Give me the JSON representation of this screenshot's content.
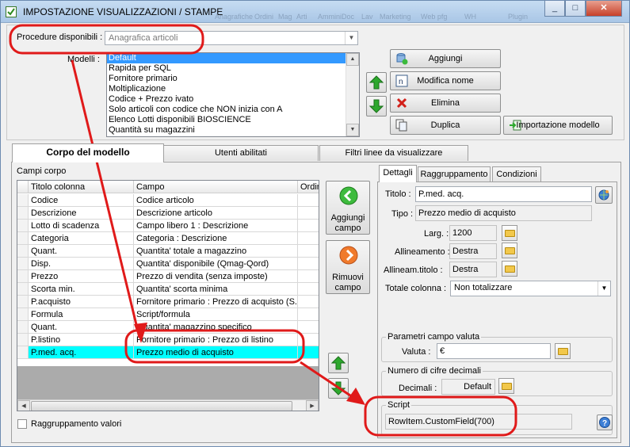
{
  "window": {
    "title": "IMPOSTAZIONE VISUALIZZAZIONI / STAMPE",
    "background_menu": [
      "Anagrafiche",
      "Ordini",
      "Mag",
      "Arti",
      "Ammini",
      "Doc",
      "Lav",
      "Marketing",
      "Web pfg",
      "WH",
      "Plugin"
    ]
  },
  "procedure": {
    "label": "Procedure disponibili :",
    "value": "Anagrafica articoli"
  },
  "modelli": {
    "label": "Modelli :",
    "items": [
      "Default",
      "Rapida per SQL",
      "Fornitore primario",
      "Moltiplicazione",
      "Codice + Prezzo ivato",
      "Solo articoli con codice che NON inizia con A",
      "Elenco Lotti disponibili BIOSCIENCE",
      "Quantità su magazzini"
    ],
    "selected_index": 0
  },
  "buttons": {
    "aggiungi": "Aggiungi",
    "modifica_nome": "Modifica nome",
    "elimina": "Elimina",
    "duplica": "Duplica",
    "importazione_modello": "Importazione modello",
    "aggiungi_campo_1": "Aggiungi",
    "aggiungi_campo_2": "campo",
    "rimuovi_campo_1": "Rimuovi",
    "rimuovi_campo_2": "campo"
  },
  "tabs": [
    "Corpo del modello",
    "Utenti abilitati",
    "Filtri linee da visualizzare"
  ],
  "campi_corpo": {
    "label": "Campi corpo",
    "columns": [
      "Titolo colonna",
      "Campo",
      "Ordin"
    ],
    "rows": [
      {
        "titolo": "Codice",
        "campo": "Codice articolo"
      },
      {
        "titolo": "Descrizione",
        "campo": "Descrizione articolo"
      },
      {
        "titolo": "Lotto di scadenza",
        "campo": "Campo libero 1 : Descrizione"
      },
      {
        "titolo": "Categoria",
        "campo": "Categoria : Descrizione"
      },
      {
        "titolo": "Quant.",
        "campo": "Quantita' totale a magazzino"
      },
      {
        "titolo": "Disp.",
        "campo": "Quantita' disponibile (Qmag-Qord)"
      },
      {
        "titolo": "Prezzo",
        "campo": "Prezzo di vendita (senza imposte)"
      },
      {
        "titolo": "Scorta min.",
        "campo": "Quantita' scorta minima"
      },
      {
        "titolo": "P.acquisto",
        "campo": "Fornitore primario : Prezzo di acquisto (S..."
      },
      {
        "titolo": "Formula",
        "campo": "Script/formula"
      },
      {
        "titolo": "Quant.",
        "campo": "Quantita' magazzino specifico"
      },
      {
        "titolo": "P.listino",
        "campo": "Fornitore primario : Prezzo di listino"
      },
      {
        "titolo": "P.med. acq.",
        "campo": "Prezzo medio di acquisto"
      }
    ],
    "selected_index": 12
  },
  "raggruppamento_valori": {
    "label": "Raggruppamento valori",
    "checked": false
  },
  "detail_tabs": [
    "Dettagli",
    "Raggruppamento",
    "Condizioni"
  ],
  "dettagli": {
    "titolo_label": "Titolo :",
    "titolo_value": "P.med. acq.",
    "tipo_label": "Tipo :",
    "tipo_value": "Prezzo medio di acquisto",
    "larg_label": "Larg. :",
    "larg_value": "1200",
    "allineamento_label": "Allineamento :",
    "allineamento_value": "Destra",
    "allineam_titolo_label": "Allineam.titolo :",
    "allineam_titolo_value": "Destra",
    "totale_colonna_label": "Totale colonna :",
    "totale_colonna_value": "Non totalizzare"
  },
  "parametri_valuta": {
    "group_label": "Parametri campo valuta",
    "valuta_label": "Valuta :",
    "valuta_value": "€"
  },
  "decimali": {
    "group_label": "Numero di cifre decimali",
    "decimali_label": "Decimali :",
    "decimali_value": "Default"
  },
  "script": {
    "group_label": "Script",
    "value": "RowItem.CustomField(700)"
  },
  "colors": {
    "selection": "#3399ff",
    "row_highlight": "#00ffff",
    "annotation": "#e01a1a",
    "arrow_green": "#2da82d"
  }
}
